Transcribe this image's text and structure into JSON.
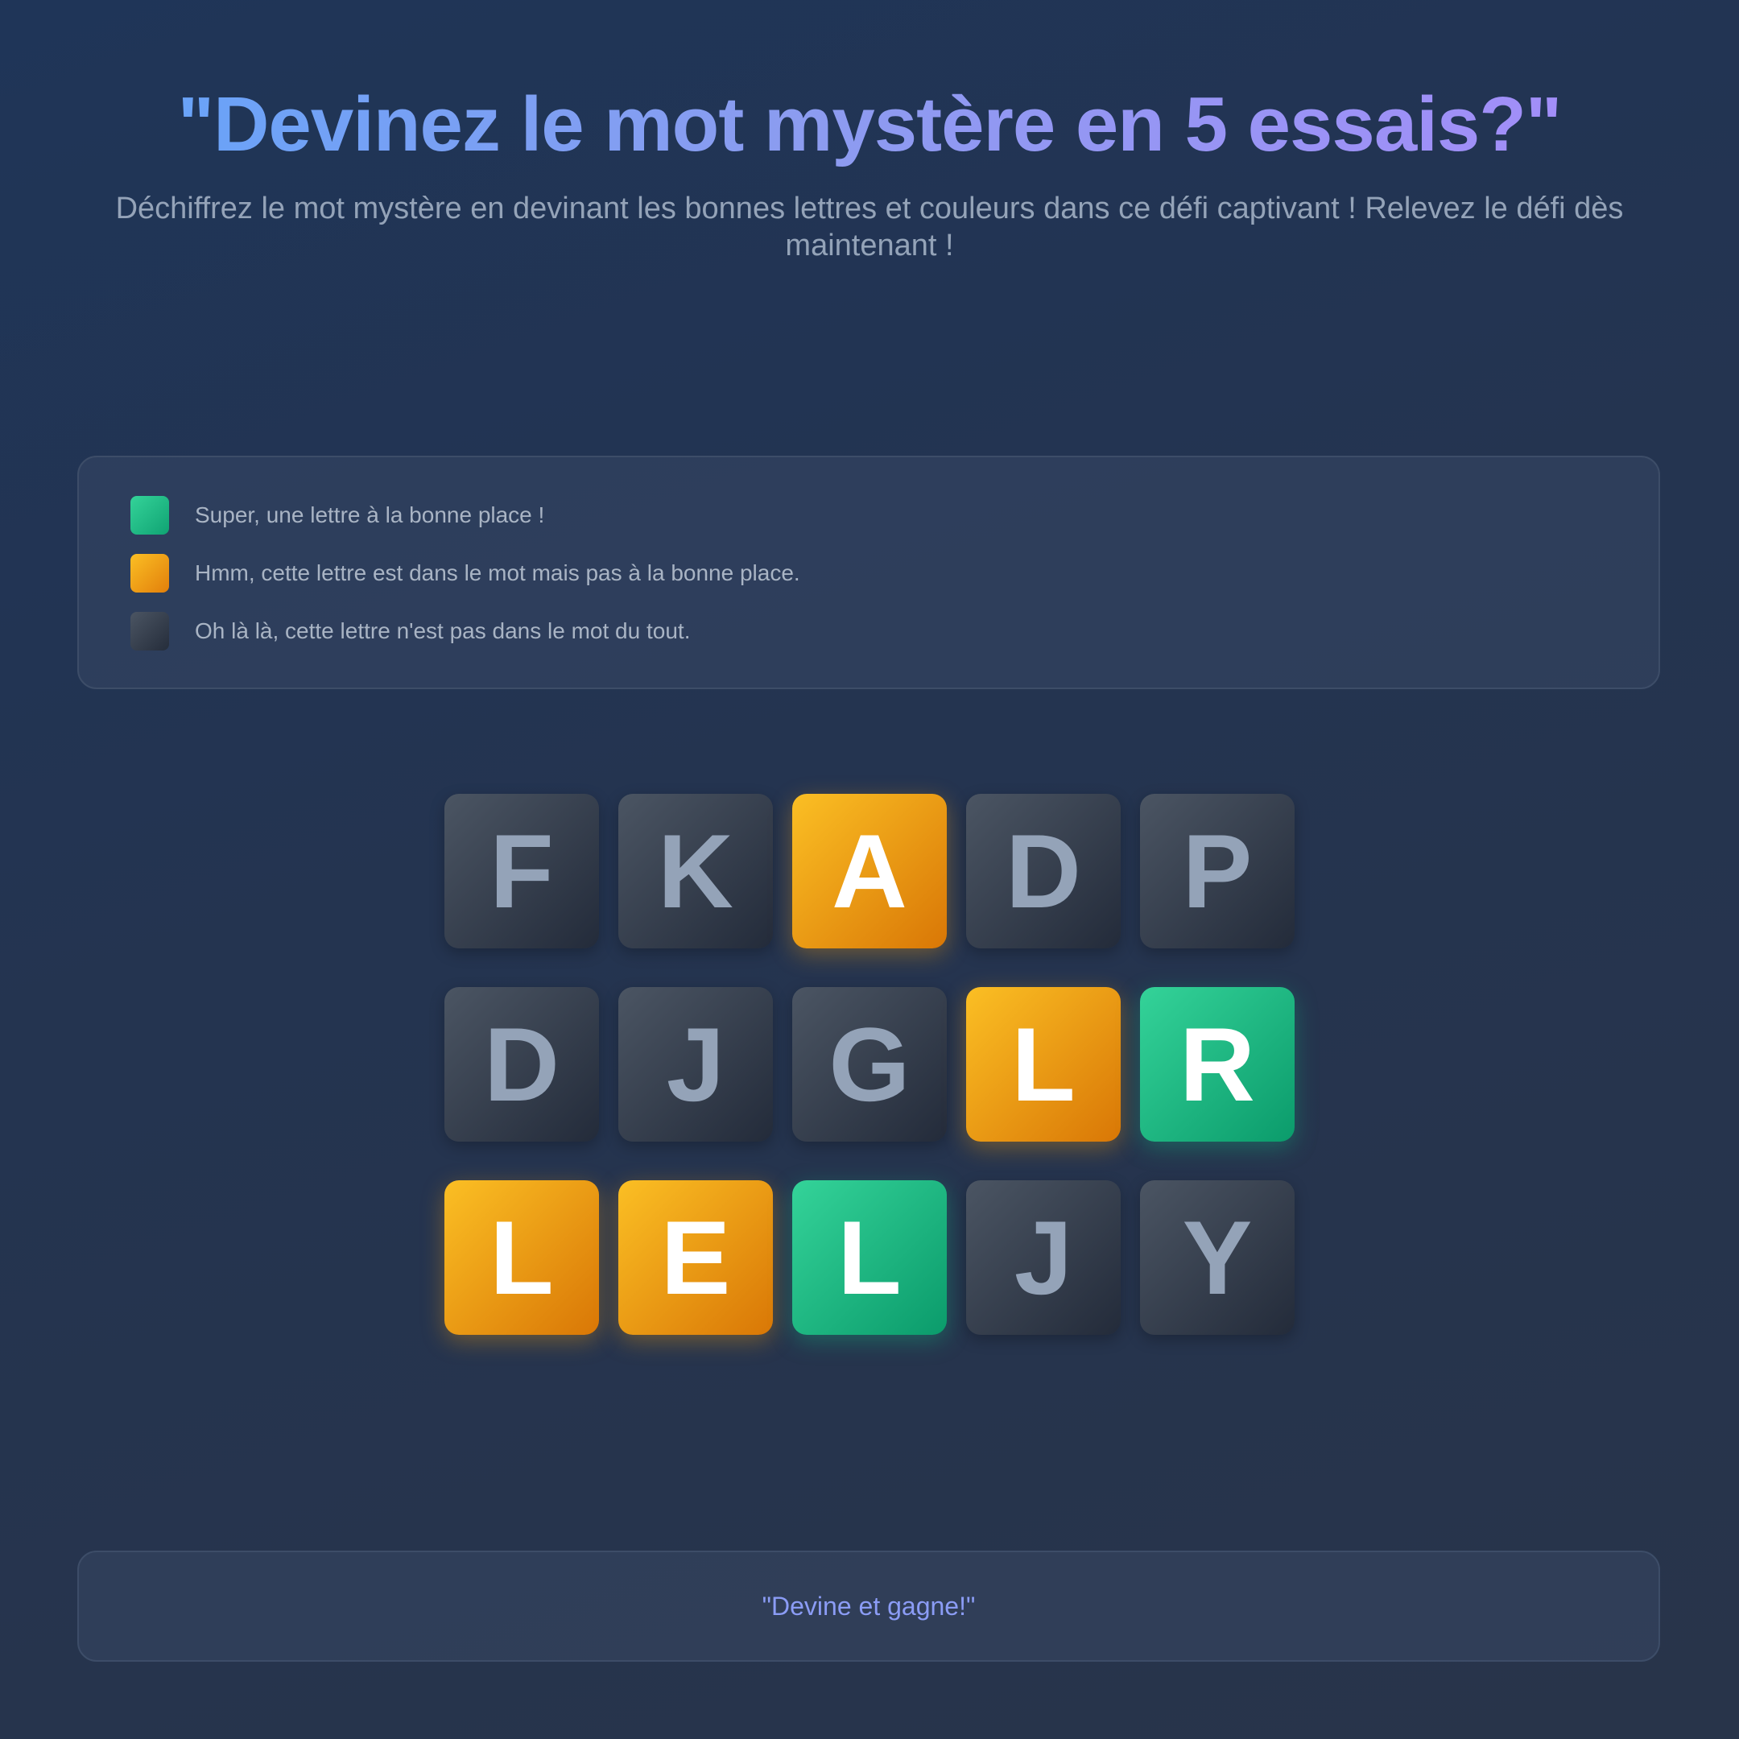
{
  "header": {
    "title": "\"Devinez le mot mystère en 5 essais?\"",
    "subtitle": "Déchiffrez le mot mystère en devinant les bonnes lettres et couleurs dans ce défi captivant ! Relevez le défi dès maintenant !"
  },
  "legend": {
    "items": [
      {
        "state": "correct",
        "color": "#10b981",
        "text": "Super, une lettre à la bonne place !"
      },
      {
        "state": "present",
        "color": "#f59e0b",
        "text": "Hmm, cette lettre est dans le mot mais pas à la bonne place."
      },
      {
        "state": "absent",
        "color": "#374151",
        "text": "Oh là là, cette lettre n'est pas dans le mot du tout."
      }
    ]
  },
  "board": {
    "rows": [
      [
        {
          "letter": "F",
          "state": "absent"
        },
        {
          "letter": "K",
          "state": "absent"
        },
        {
          "letter": "A",
          "state": "present"
        },
        {
          "letter": "D",
          "state": "absent"
        },
        {
          "letter": "P",
          "state": "absent"
        }
      ],
      [
        {
          "letter": "D",
          "state": "absent"
        },
        {
          "letter": "J",
          "state": "absent"
        },
        {
          "letter": "G",
          "state": "absent"
        },
        {
          "letter": "L",
          "state": "present"
        },
        {
          "letter": "R",
          "state": "correct"
        }
      ],
      [
        {
          "letter": "L",
          "state": "present"
        },
        {
          "letter": "E",
          "state": "present"
        },
        {
          "letter": "L",
          "state": "correct"
        },
        {
          "letter": "J",
          "state": "absent"
        },
        {
          "letter": "Y",
          "state": "absent"
        }
      ]
    ]
  },
  "footer": {
    "text": "\"Devine et gagne!\""
  },
  "colors": {
    "correct": "#10b981",
    "present": "#f59e0b",
    "absent": "#374151",
    "title_gradient_start": "#60a5fa",
    "title_gradient_end": "#a78bfa"
  }
}
